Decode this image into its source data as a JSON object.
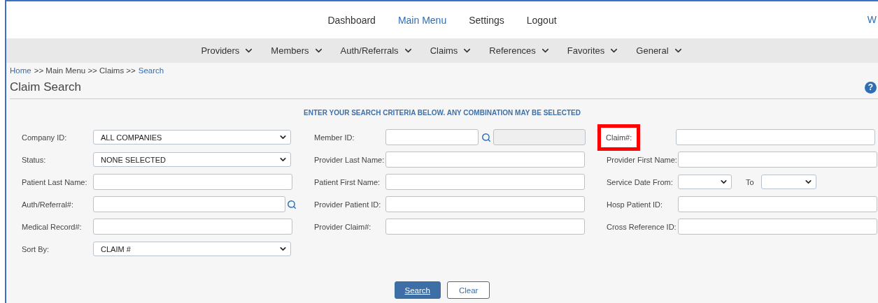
{
  "top_nav": [
    {
      "label": "Dashboard",
      "selected": false
    },
    {
      "label": "Main Menu",
      "selected": true
    },
    {
      "label": "Settings",
      "selected": false
    },
    {
      "label": "Logout",
      "selected": false
    }
  ],
  "top_nav_cut": "W",
  "menu": [
    "Providers",
    "Members",
    "Auth/Referrals",
    "Claims",
    "References",
    "Favorites",
    "General"
  ],
  "breadcrumb": [
    {
      "label": "Home",
      "link": true
    },
    {
      "label": ">> Main Menu >> Claims >>",
      "link": false
    },
    {
      "label": "Search",
      "link": true
    }
  ],
  "page_title": "Claim Search",
  "help": "?",
  "instructions": "ENTER YOUR SEARCH CRITERIA BELOW. ANY COMBINATION MAY BE SELECTED",
  "columns": [
    [
      {
        "kind": "select",
        "label": "Company ID:",
        "value": "ALL COMPANIES"
      },
      {
        "kind": "select",
        "label": "Status:",
        "value": "NONE SELECTED"
      },
      {
        "kind": "input",
        "label": "Patient Last Name:"
      },
      {
        "kind": "lookup",
        "label": "Auth/Referral#:"
      },
      {
        "kind": "input",
        "label": "Medical Record#:"
      },
      {
        "kind": "select",
        "label": "Sort By:",
        "value": "CLAIM #"
      }
    ],
    [
      {
        "kind": "member",
        "label": "Member ID:"
      },
      {
        "kind": "input",
        "label": "Provider Last Name:"
      },
      {
        "kind": "input",
        "label": "Patient First Name:"
      },
      {
        "kind": "input",
        "label": "Provider Patient ID:"
      },
      {
        "kind": "input",
        "label": "Provider Claim#:"
      }
    ],
    [
      {
        "kind": "input",
        "label": "Claim#:",
        "highlighted": true
      },
      {
        "kind": "input",
        "label": "Provider First Name:"
      },
      {
        "kind": "daterange",
        "label": "Service Date From:",
        "to_label": "To"
      },
      {
        "kind": "input",
        "label": "Hosp Patient ID:"
      },
      {
        "kind": "input",
        "label": "Cross Reference ID:"
      }
    ]
  ],
  "buttons": [
    {
      "label": "Search",
      "primary": true
    },
    {
      "label": "Clear",
      "primary": false
    }
  ]
}
